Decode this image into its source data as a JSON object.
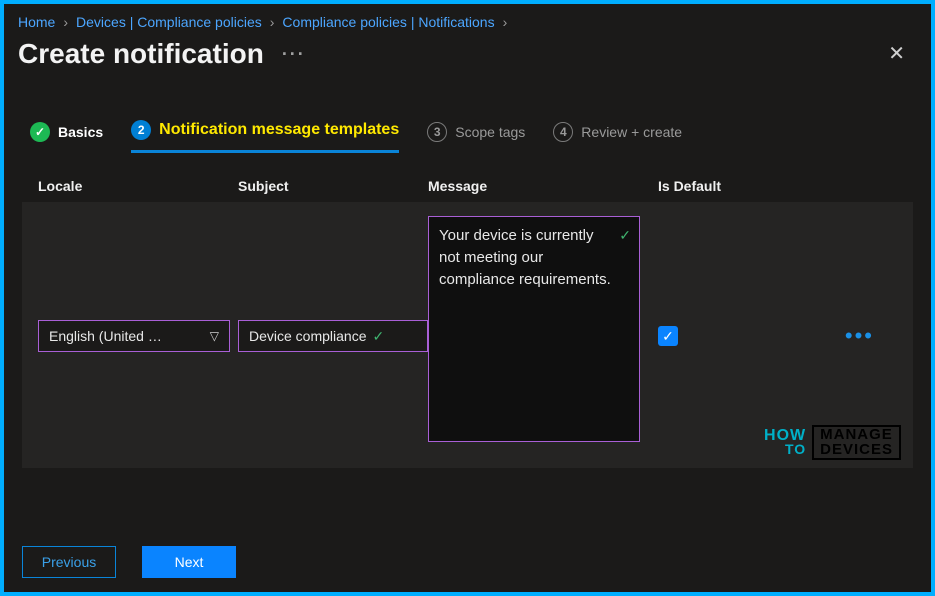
{
  "breadcrumb": {
    "items": [
      "Home",
      "Devices | Compliance policies",
      "Compliance policies | Notifications"
    ]
  },
  "header": {
    "title": "Create notification",
    "more": "···"
  },
  "steps": {
    "s1": {
      "num_icon": "✓",
      "label": "Basics"
    },
    "s2": {
      "num": "2",
      "label": "Notification message templates"
    },
    "s3": {
      "num": "3",
      "label": "Scope tags"
    },
    "s4": {
      "num": "4",
      "label": "Review + create"
    }
  },
  "grid": {
    "headers": {
      "locale": "Locale",
      "subject": "Subject",
      "message": "Message",
      "isdefault": "Is Default"
    },
    "row": {
      "locale": "English (United …",
      "subject": "Device compliance",
      "message": "Your device is currently not meeting our compliance requirements.",
      "isdefault": true
    }
  },
  "footer": {
    "prev": "Previous",
    "next": "Next"
  },
  "watermark": {
    "how": "HOW",
    "to": "TO",
    "line1": "MANAGE",
    "line2": "DEVICES"
  }
}
